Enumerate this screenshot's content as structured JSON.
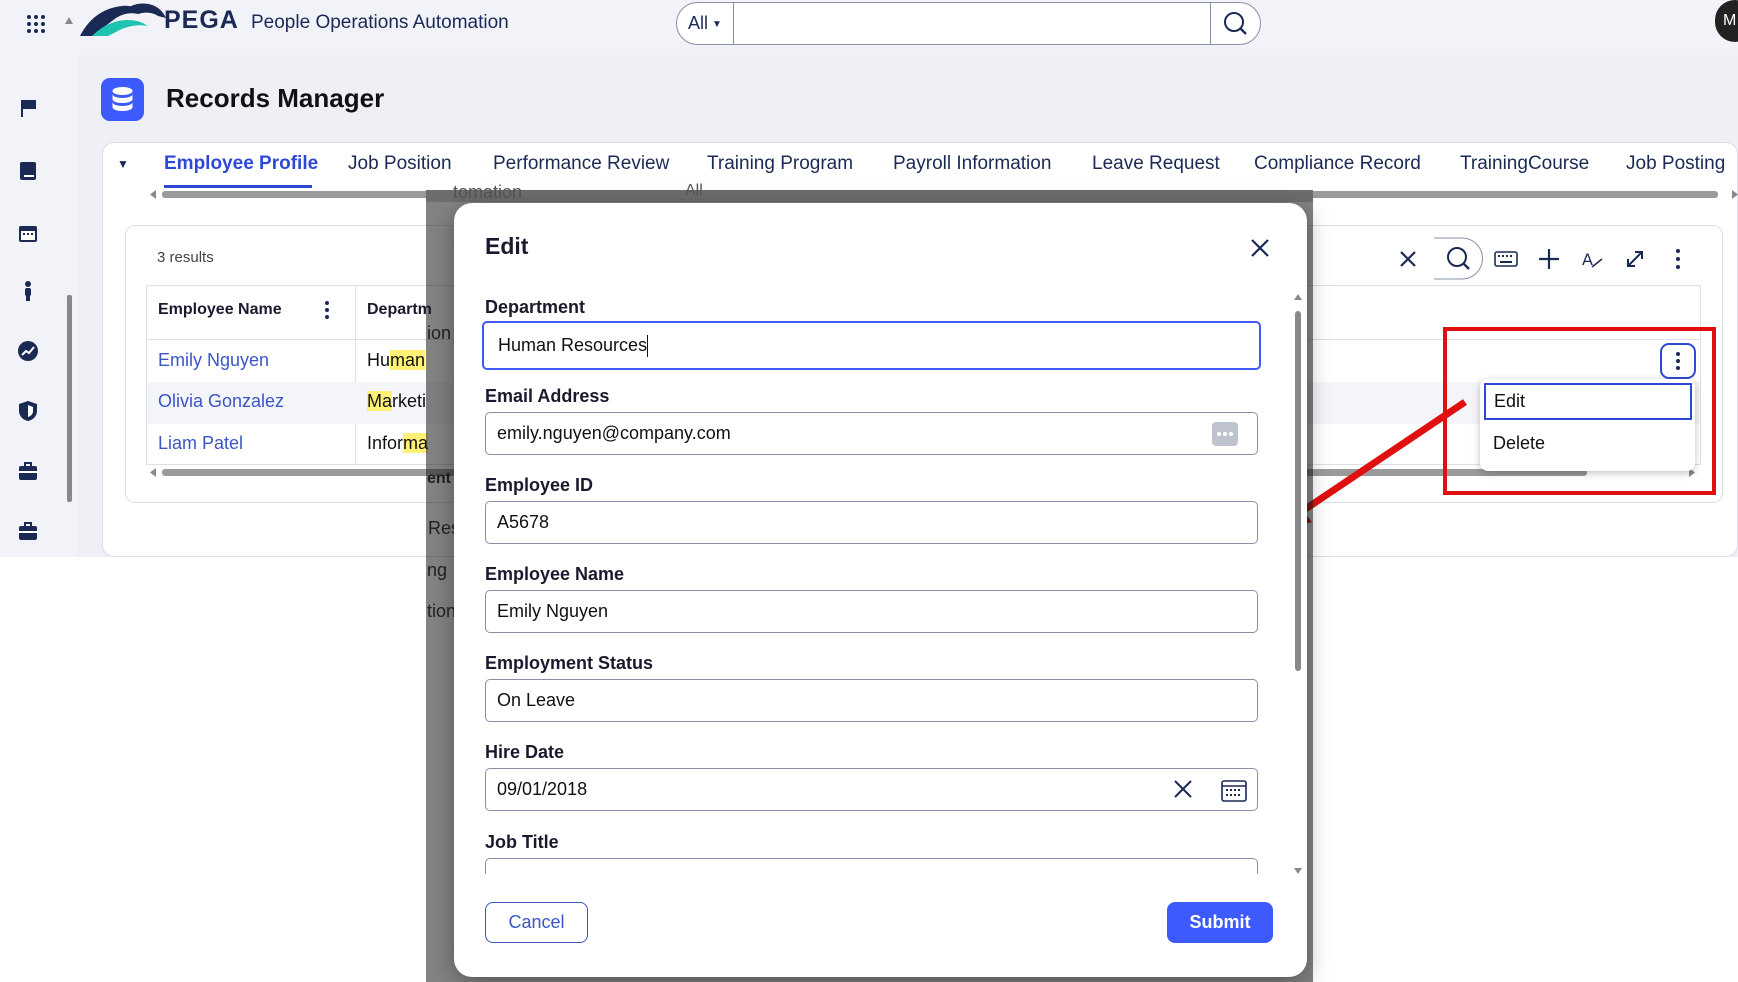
{
  "header": {
    "brand": "PEGA",
    "app_name": "People Operations Automation",
    "search_scope": "All",
    "avatar_initial": "M"
  },
  "sidebar": {
    "icons": [
      "flag-icon",
      "book-icon",
      "calendar-icon",
      "person-icon",
      "trend-icon",
      "shield-icon",
      "briefcase-icon",
      "briefcase-icon"
    ]
  },
  "page": {
    "title": "Records Manager",
    "tabs": [
      "Employee Profile",
      "Job Position",
      "Performance Review",
      "Training Program",
      "Payroll Information",
      "Leave Request",
      "Compliance Record",
      "TrainingCourse",
      "Job Posting"
    ],
    "active_tab": "Employee Profile"
  },
  "table": {
    "results": "3 results",
    "columns": [
      "Employee Name",
      "Departm"
    ],
    "rows": [
      {
        "name": "Emily Nguyen",
        "dept_pre": "Hu",
        "dept_hl": "man",
        "dept_post": ""
      },
      {
        "name": "Olivia Gonzalez",
        "dept_pre": "",
        "dept_hl": "Ma",
        "dept_post": "rketi"
      },
      {
        "name": "Liam Patel",
        "dept_pre": "Infor",
        "dept_hl": "ma",
        "dept_post": ""
      }
    ]
  },
  "row_menu": {
    "edit": "Edit",
    "delete": "Delete"
  },
  "background_fragments": [
    "tomation",
    "All",
    "ion",
    "ent",
    "Res",
    "ng",
    "tion"
  ],
  "modal": {
    "title": "Edit",
    "fields": [
      {
        "label": "Department",
        "value": "Human Resources"
      },
      {
        "label": "Email Address",
        "value": "emily.nguyen@company.com"
      },
      {
        "label": "Employee ID",
        "value": "A5678"
      },
      {
        "label": "Employee Name",
        "value": "Emily Nguyen"
      },
      {
        "label": "Employment Status",
        "value": "On Leave"
      },
      {
        "label": "Hire Date",
        "value": "09/01/2018"
      },
      {
        "label": "Job Title",
        "value": ""
      }
    ],
    "cancel": "Cancel",
    "submit": "Submit"
  },
  "colors": {
    "accent": "#3d5afe",
    "link": "#3b55c7",
    "highlight": "#fff176",
    "annotation": "#e01010"
  }
}
